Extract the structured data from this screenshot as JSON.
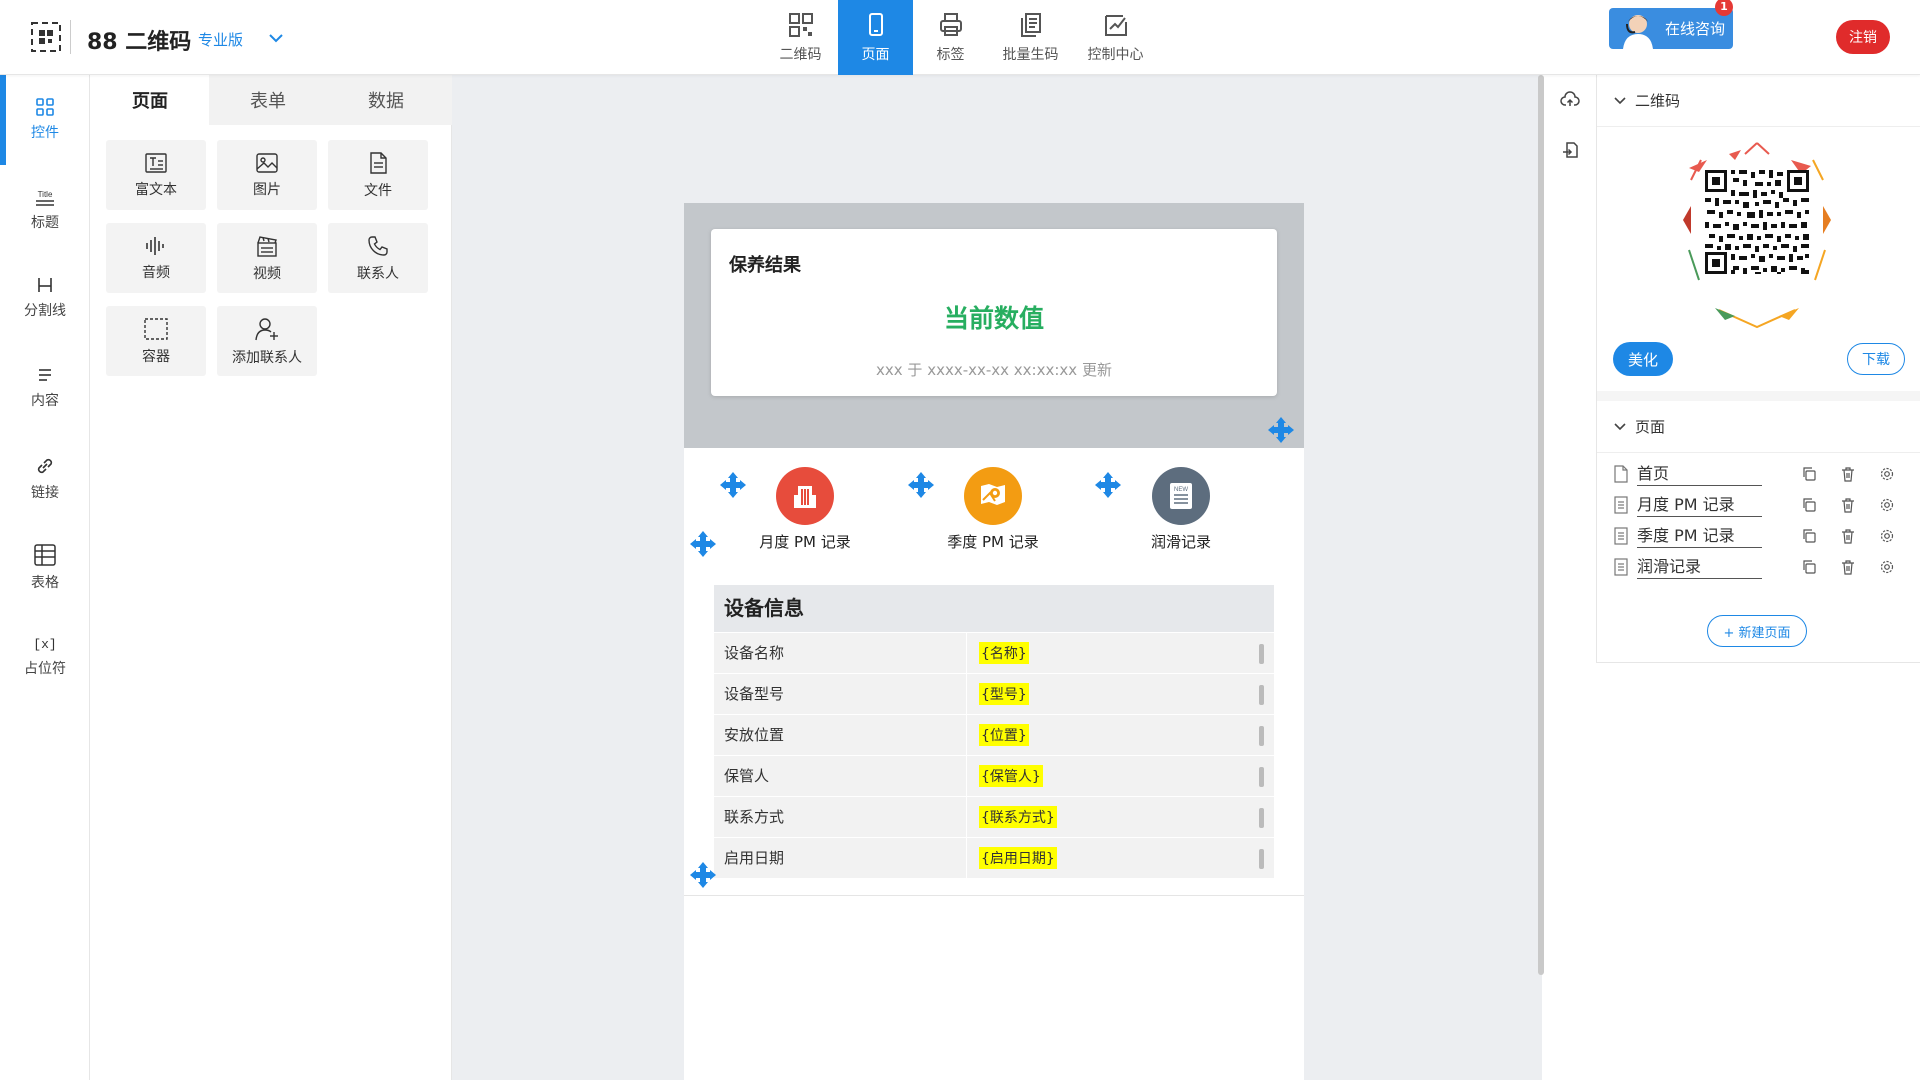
{
  "header": {
    "app_title": "88 二维码",
    "edition": "专业版",
    "nav": [
      {
        "label": "二维码",
        "icon": "qrcode-icon"
      },
      {
        "label": "页面",
        "icon": "mobile-page-icon",
        "active": true
      },
      {
        "label": "标签",
        "icon": "printer-icon"
      },
      {
        "label": "批量生码",
        "icon": "batch-icon"
      },
      {
        "label": "控制中心",
        "icon": "dashboard-icon"
      }
    ],
    "consult": {
      "label": "在线咨询",
      "badge": "1"
    },
    "logout": "注销"
  },
  "left_rail": {
    "items": [
      {
        "label": "控件",
        "icon": "widgets-icon",
        "active": true
      },
      {
        "label": "标题",
        "icon": "title-icon"
      },
      {
        "label": "分割线",
        "icon": "divider-icon"
      },
      {
        "label": "内容",
        "icon": "content-icon"
      },
      {
        "label": "链接",
        "icon": "link-icon"
      },
      {
        "label": "表格",
        "icon": "table-icon"
      },
      {
        "label": "占位符",
        "icon": "placeholder-icon"
      }
    ],
    "title_icon_text": "Title",
    "placeholder_icon_text": "[x]"
  },
  "widget_panel": {
    "tabs": [
      "页面",
      "表单",
      "数据"
    ],
    "active_tab": "页面",
    "widgets": [
      {
        "label": "富文本",
        "icon": "rich-text-icon"
      },
      {
        "label": "图片",
        "icon": "image-icon"
      },
      {
        "label": "文件",
        "icon": "file-icon"
      },
      {
        "label": "音频",
        "icon": "audio-icon"
      },
      {
        "label": "视频",
        "icon": "video-icon"
      },
      {
        "label": "联系人",
        "icon": "phone-icon"
      },
      {
        "label": "容器",
        "icon": "container-icon"
      },
      {
        "label": "添加联系人",
        "icon": "add-contact-icon"
      }
    ]
  },
  "canvas": {
    "result_card": {
      "title": "保养结果",
      "value": "当前数值",
      "meta": "xxx 于 xxxx-xx-xx xx:xx:xx 更新",
      "value_color": "#27ae60"
    },
    "links": [
      {
        "label": "月度 PM 记录",
        "color": "#e74c3c",
        "icon": "building-icon"
      },
      {
        "label": "季度 PM 记录",
        "color": "#f39c12",
        "icon": "map-pin-icon"
      },
      {
        "label": "润滑记录",
        "color": "#5d6d7e",
        "icon": "news-icon"
      }
    ],
    "news_icon_text": "NEW",
    "info_table": {
      "title": "设备信息",
      "rows": [
        {
          "label": "设备名称",
          "value": "{名称}"
        },
        {
          "label": "设备型号",
          "value": "{型号}"
        },
        {
          "label": "安放位置",
          "value": "{位置}"
        },
        {
          "label": "保管人",
          "value": "{保管人}"
        },
        {
          "label": "联系方式",
          "value": "{联系方式}"
        },
        {
          "label": "启用日期",
          "value": "{启用日期}"
        }
      ]
    }
  },
  "right_panel": {
    "qr_section": "二维码",
    "beautify": "美化",
    "download": "下载",
    "pages_section": "页面",
    "pages": [
      "首页",
      "月度 PM 记录",
      "季度 PM 记录",
      "润滑记录"
    ],
    "new_page": "+ 新建页面"
  },
  "colors": {
    "accent": "#1e88e5",
    "danger": "#e02b2b"
  }
}
